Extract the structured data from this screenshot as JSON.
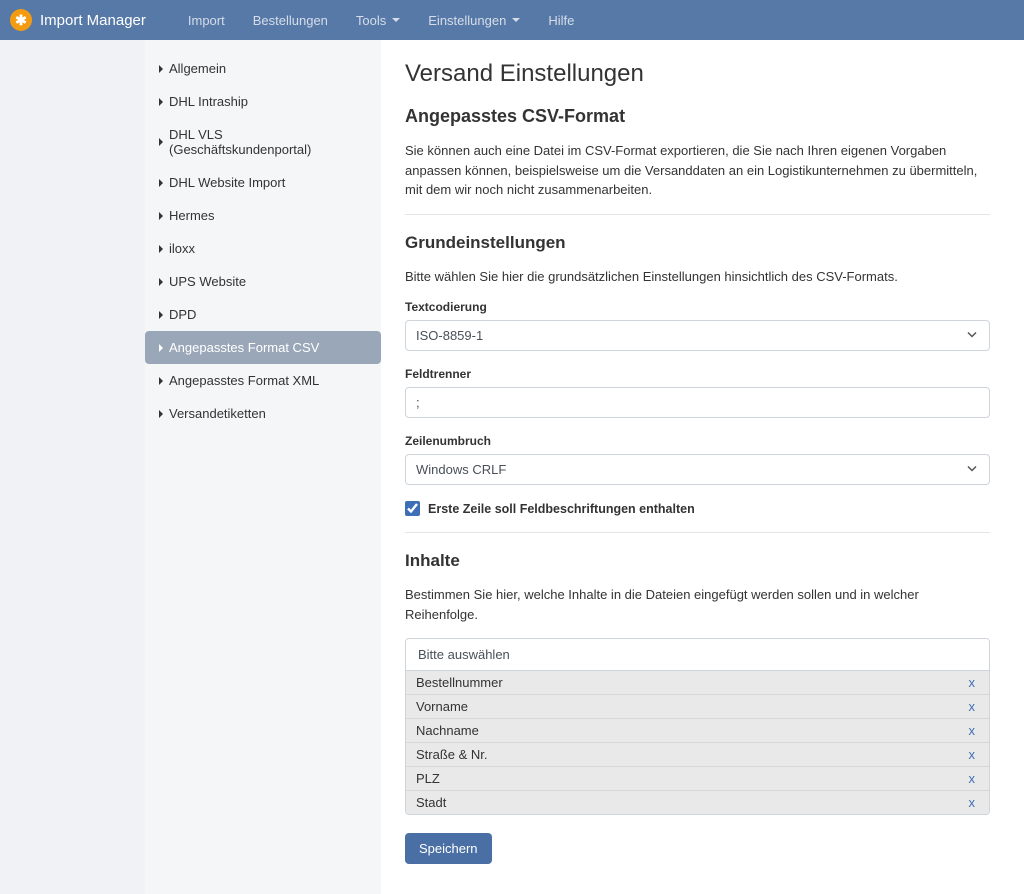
{
  "brand": "Import Manager",
  "nav": [
    {
      "label": "Import",
      "dropdown": false
    },
    {
      "label": "Bestellungen",
      "dropdown": false
    },
    {
      "label": "Tools",
      "dropdown": true
    },
    {
      "label": "Einstellungen",
      "dropdown": true
    },
    {
      "label": "Hilfe",
      "dropdown": false
    }
  ],
  "sidebar": {
    "items": [
      "Allgemein",
      "DHL Intraship",
      "DHL VLS (Geschäftskundenportal)",
      "DHL Website Import",
      "Hermes",
      "iloxx",
      "UPS Website",
      "DPD",
      "Angepasstes Format CSV",
      "Angepasstes Format XML",
      "Versandetiketten"
    ],
    "activeIndex": 8
  },
  "page": {
    "title": "Versand Einstellungen",
    "section1": {
      "heading": "Angepasstes CSV-Format",
      "desc": "Sie können auch eine Datei im CSV-Format exportieren, die Sie nach Ihren eigenen Vorgaben anpassen können, beispielsweise um die Versanddaten an ein Logistikunternehmen zu übermitteln, mit dem wir noch nicht zusammenarbeiten."
    },
    "section2": {
      "heading": "Grundeinstellungen",
      "desc": "Bitte wählen Sie hier die grundsätzlichen Einstellungen hinsichtlich des CSV-Formats.",
      "encoding_label": "Textcodierung",
      "encoding_value": "ISO-8859-1",
      "delimiter_label": "Feldtrenner",
      "delimiter_value": ";",
      "linebreak_label": "Zeilenumbruch",
      "linebreak_value": "Windows CRLF",
      "header_checkbox_label": "Erste Zeile soll Feldbeschriftungen enthalten",
      "header_checked": true
    },
    "section3": {
      "heading": "Inhalte",
      "desc": "Bestimmen Sie hier, welche Inhalte in die Dateien eingefügt werden sollen und in welcher Reihenfolge.",
      "placeholder": "Bitte auswählen",
      "items": [
        "Bestellnummer",
        "Vorname",
        "Nachname",
        "Straße & Nr.",
        "PLZ",
        "Stadt"
      ]
    },
    "save_label": "Speichern"
  }
}
